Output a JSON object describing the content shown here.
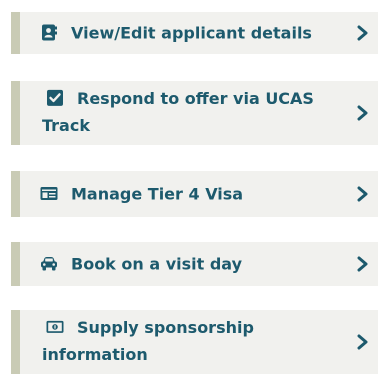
{
  "menu": {
    "items": [
      {
        "label": "View/Edit applicant details",
        "icon": "contact-book-icon"
      },
      {
        "label": "Respond to offer via UCAS Track",
        "icon": "checkbox-icon"
      },
      {
        "label": "Manage Tier 4 Visa",
        "icon": "id-card-icon"
      },
      {
        "label": "Book on a visit day",
        "icon": "car-icon"
      },
      {
        "label": "Supply sponsorship information",
        "icon": "banknote-icon"
      }
    ]
  },
  "colors": {
    "text": "#1d5a6d",
    "item_background": "#f1f1ee",
    "accent_border": "#c9cbb5"
  }
}
